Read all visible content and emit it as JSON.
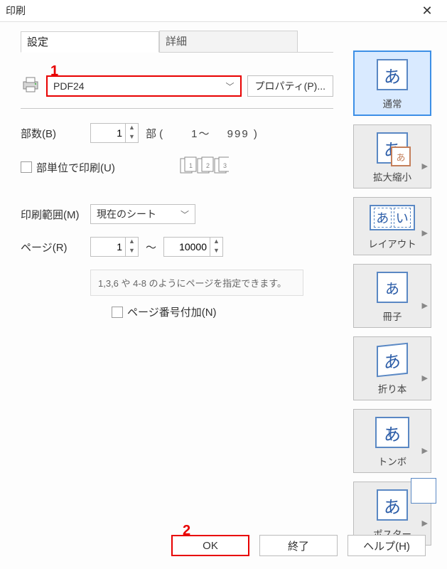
{
  "title": "印刷",
  "annotations": {
    "a1": "1",
    "a2": "2"
  },
  "tabs": {
    "settings": "設定",
    "detail": "詳細"
  },
  "printer": {
    "selected": "PDF24",
    "properties_btn": "プロパティ(P)..."
  },
  "copies": {
    "label": "部数(B)",
    "value": "1",
    "unit": "部 (",
    "range": "1〜　 999 )"
  },
  "collate": {
    "label": "部単位で印刷(U)"
  },
  "print_range": {
    "label": "印刷範囲(M)",
    "selected": "現在のシート"
  },
  "pages": {
    "label": "ページ(R)",
    "from": "1",
    "tilde": "〜",
    "to": "10000",
    "hint": "1,3,6 や 4-8 のようにページを指定できます。",
    "pagenum_label": "ページ番号付加(N)"
  },
  "presets": {
    "normal": "通常",
    "zoom": "拡大縮小",
    "layout": "レイアウト",
    "booklet": "冊子",
    "fold": "折り本",
    "trim": "トンボ",
    "poster": "ポスター"
  },
  "buttons": {
    "ok": "OK",
    "cancel": "終了",
    "help": "ヘルプ(H)"
  }
}
